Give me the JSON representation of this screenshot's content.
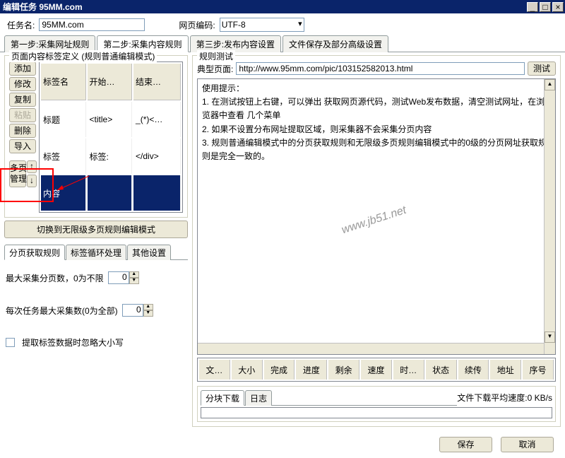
{
  "window": {
    "title": "编辑任务 95MM.com",
    "min": "_",
    "max": "□",
    "close": "×"
  },
  "top": {
    "task_name_label": "任务名:",
    "task_name_value": "95MM.com",
    "encoding_label": "网页编码:",
    "encoding_value": "UTF-8"
  },
  "main_tabs": [
    "第一步:采集网址规则",
    "第二步:采集内容规则",
    "第三步:发布内容设置",
    "文件保存及部分高级设置"
  ],
  "left": {
    "group_legend": "页面内容标签定义 (规则普通编辑模式)",
    "buttons": [
      "添加",
      "修改",
      "复制",
      "粘贴",
      "删除",
      "导入"
    ],
    "disabled_index": 3,
    "multi_page_label": "多页\n管理",
    "up": "↑",
    "down": "↓",
    "table_headers": [
      "标签名",
      "开始…",
      "结束…"
    ],
    "table_rows": [
      {
        "name": "标题",
        "start": "<title>",
        "end": "_(*)<…"
      },
      {
        "name": "标签",
        "start": "标签:",
        "end": "</div>"
      },
      {
        "name": "内容",
        "start": "",
        "end": ""
      }
    ],
    "switch_mode": "切换到无限级多页规则编辑模式",
    "sub_tabs": [
      "分页获取规则",
      "标签循环处理",
      "其他设置"
    ],
    "max_pages_label": "最大采集分页数，0为不限",
    "max_pages_value": "0",
    "per_task_label": "每次任务最大采集数(0为全部)",
    "per_task_value": "0",
    "ignore_case_label": "提取标签数据时忽略大小写"
  },
  "right": {
    "legend": "规则测试",
    "url_label": "典型页面:",
    "url_value": "http://www.95mm.com/pic/103152582013.html",
    "test_btn": "测试",
    "usage_title": "使用提示：",
    "usage_lines": [
      "1. 在测试按钮上右键，可以弹出 获取网页源代码，测试Web发布数据，清空测试网址，在浏览器中查看 几个菜单",
      "2. 如果不设置分布网址提取区域，则采集器不会采集分页内容",
      "3. 规则普通编辑模式中的分页获取规则和无限级多页规则编辑模式中的0级的分页网址获取规则是完全一致的。"
    ],
    "watermark": "www.jb51.net",
    "dl_headers": [
      "文…",
      "大小",
      "完成",
      "进度",
      "剩余",
      "速度",
      "时…",
      "状态",
      "续传",
      "地址",
      "序号"
    ],
    "status_tabs": [
      "分块下载",
      "日志"
    ],
    "avg_speed_label": "文件下载平均速度:",
    "avg_speed_value": "0 KB/s"
  },
  "bottom": {
    "save": "保存",
    "cancel": "取消"
  }
}
